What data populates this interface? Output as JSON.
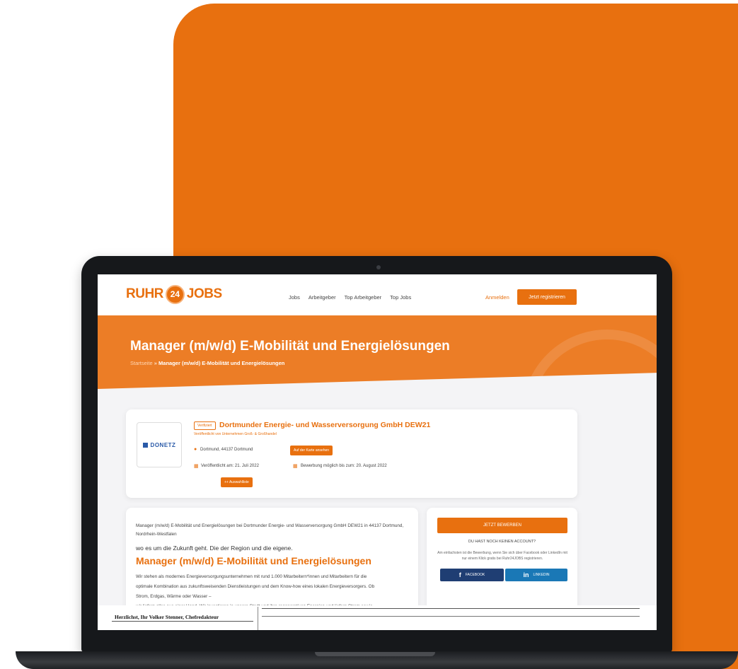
{
  "header": {
    "logo_left": "RUHR",
    "logo_badge": "24",
    "logo_right": "JOBS",
    "nav": [
      "Jobs",
      "Arbeitgeber",
      "Top Arbeitgeber",
      "Top Jobs"
    ],
    "login": "Anmelden",
    "register": "Jetzt registrieren"
  },
  "hero": {
    "title": "Manager (m/w/d) E-Mobilität und Energielösungen",
    "breadcrumb_home": "Startseite",
    "breadcrumb_sep": "»",
    "breadcrumb_current": "Manager (m/w/d) E-Mobilität und Energielösungen"
  },
  "company": {
    "logo_name": "DONETZ",
    "verified": "Verifiziert",
    "name": "Dortmunder Energie- und Wasserversorgung GmbH DEW21",
    "sub": "Veröffentlicht von Unternehmen Groß- & Großhandel",
    "location": "Dortmund, 44137 Dortmund",
    "map_button": "Auf der Karte ansehen",
    "published": "Veröffentlicht am: 21. Juli 2022",
    "deadline": "Bewerbung möglich bis zum: 20. August 2022",
    "select_button": "++ Auswahlliste"
  },
  "content": {
    "intro": "Manager (m/w/d) E-Mobilität und Energielösungen bei Dortmunder Energie- und Wasserversorgung GmbH DEW21 in 44137 Dortmund, Nordrhein-Westfalen",
    "tagline": "wo es um die Zukunft geht. Die der Region und die eigene.",
    "heading": "Manager (m/w/d) E-Mobilität und Energielösungen",
    "body_1": "Wir stehen als modernes Energieversorgungsunternehmen mit rund 1.000 Mitarbeitern*innen und Mitarbeitern für die",
    "body_2": "optimale Kombination aus zukunftsweisenden Dienstleistungen und dem Know-how eines lokalen Energieversorgers. Ob",
    "body_3": "Strom, Erdgas, Wärme oder Wasser –",
    "body_4": "wir liefern alles aus einer Hand. Wir investieren in unsere Stadt und ihre regenerativen Energien und liefern Strom sowie"
  },
  "sidebar": {
    "apply": "JETZT BEWERBEN",
    "no_account": "DU HAST NOCH KEINEN ACCOUNT?",
    "note": "Am einfachsten ist die Bewerbung, wenn Sie sich über Facebook oder LinkedIn mit nur einem Klick gratis bei Ruhr24JOBS registrieren.",
    "facebook_icon": "f",
    "facebook": "FACEBOOK",
    "linkedin_icon": "in",
    "linkedin": "LINKEDIN"
  },
  "overlay": {
    "signoff": "Herzlichst, Ihr Volker Stenner, Chefredakteur"
  },
  "colors": {
    "brand_orange": "#e8700f",
    "facebook_blue": "#1f3e73",
    "linkedin_blue": "#1a78b6"
  }
}
